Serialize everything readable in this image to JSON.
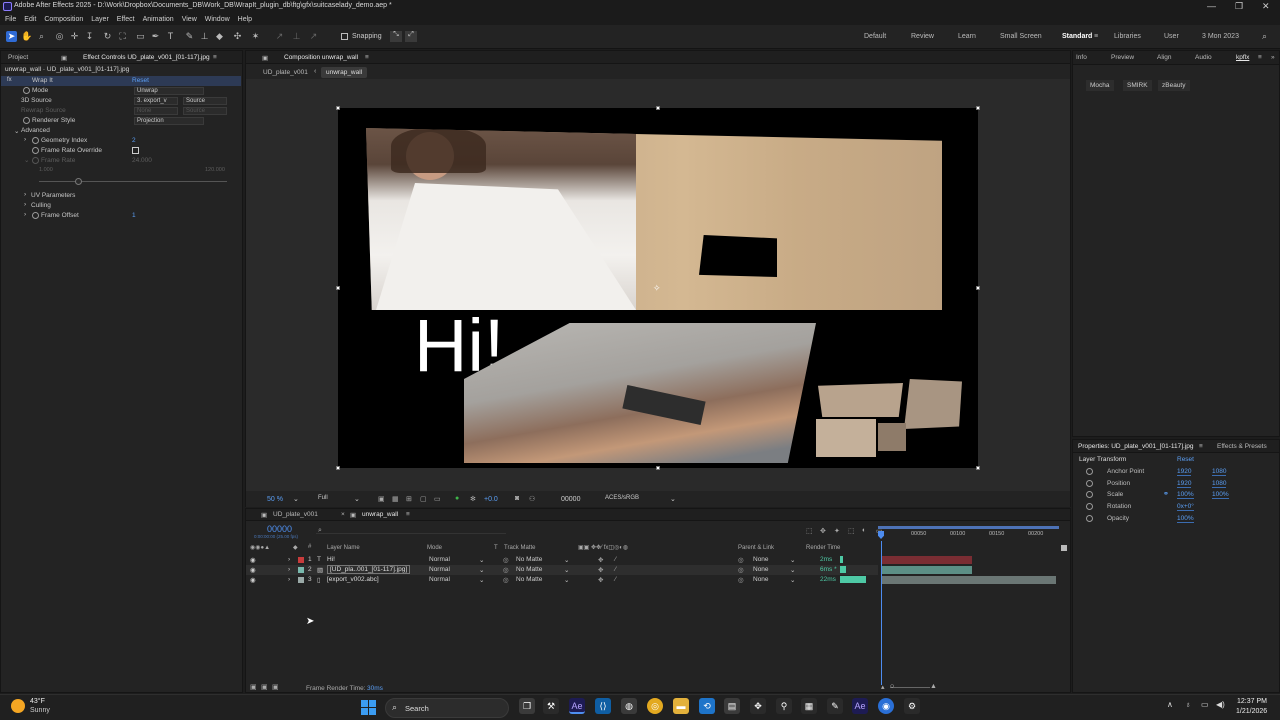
{
  "window": {
    "title": "Adobe After Effects 2025 - D:\\Work\\Dropbox\\Documents_DB\\Work_DB\\WrapIt_plugin_db\\ftg\\gfx\\suitcaselady_demo.aep *",
    "controls": [
      "—",
      "❐",
      "✕"
    ]
  },
  "menu": [
    "File",
    "Edit",
    "Composition",
    "Layer",
    "Effect",
    "Animation",
    "View",
    "Window",
    "Help"
  ],
  "toolbar": {
    "snapping_label": "Snapping",
    "workspaces": [
      "Default",
      "Review",
      "Learn",
      "Small Screen",
      "Standard",
      "Libraries",
      "User",
      "3 Mon 2023"
    ]
  },
  "left_panel": {
    "tabs": [
      "Project",
      "Effect Controls UD_plate_v001_[01-117].jpg"
    ],
    "header": "unwrap_wall · UD_plate_v001_[01-117].jpg",
    "effect_name": "Wrap It",
    "reset": "Reset",
    "mode_label": "Mode",
    "mode_value": "Unwrap",
    "source3d_label": "3D Source",
    "source3d_value": "3. export_v",
    "source3d_value2": "Source",
    "rewrap_label": "Rewrap Source",
    "rewrap_value": "None",
    "rewrap_value2": "Source",
    "renderer_label": "Renderer Style",
    "renderer_value": "Projection",
    "advanced_label": "Advanced",
    "geometry_label": "Geometry Index",
    "geometry_value": "2",
    "framerate_override_label": "Frame Rate Override",
    "framerate_label": "Frame Rate",
    "framerate_value": "24.000",
    "slider_min": "1.000",
    "slider_max": "120.000",
    "uv_label": "UV Parameters",
    "culling_label": "Culling",
    "frame_offset_label": "Frame Offset",
    "frame_offset_value": "1"
  },
  "comp_panel": {
    "tab": "Composition unwrap_wall",
    "breadcrumbs": [
      "UD_plate_v001",
      "unwrap_wall"
    ],
    "overlay_text": "Hi!",
    "zoom": "50 %",
    "resolution": "Full",
    "exposure": "+0.0",
    "timecode": "00000",
    "color_space": "ACES/sRGB"
  },
  "right_panel": {
    "tabs": [
      "Info",
      "Preview",
      "Align",
      "Audio",
      "kpflx"
    ],
    "buttons": [
      "Mocha",
      "SMIRK",
      "zBeauty"
    ]
  },
  "properties": {
    "tab": "Properties: UD_plate_v001_[01-117].jpg",
    "tab2": "Effects & Presets",
    "section": "Layer Transform",
    "reset": "Reset",
    "rows": [
      {
        "label": "Anchor Point",
        "v1": "1920",
        "v2": "1080"
      },
      {
        "label": "Position",
        "v1": "1920",
        "v2": "1080"
      },
      {
        "label": "Scale",
        "v1": "100%",
        "v2": "100%"
      },
      {
        "label": "Rotation",
        "v1": "0x+0°",
        "v2": ""
      },
      {
        "label": "Opacity",
        "v1": "100%",
        "v2": ""
      }
    ]
  },
  "timeline": {
    "tabs": [
      "UD_plate_v001",
      "unwrap_wall"
    ],
    "timecode": "00000",
    "timecode_sub": "0:00:00:00 (25.00 fps)",
    "headers": [
      "Layer Name",
      "Mode",
      "T",
      "Track Matte",
      "Parent & Link",
      "Render Time"
    ],
    "ruler": [
      "00050",
      "00100",
      "00150",
      "00200"
    ],
    "layers": [
      {
        "num": "1",
        "name": "Hi!",
        "mode": "Normal",
        "matte": "No Matte",
        "parent": "None",
        "render": "2ms",
        "color": "#c83c3c"
      },
      {
        "num": "2",
        "name": "[UD_pla..001_[01-117].jpg]",
        "mode": "Normal",
        "matte": "No Matte",
        "parent": "None",
        "render": "6ms *",
        "color": "#79b9ad"
      },
      {
        "num": "3",
        "name": "[export_v002.abc]",
        "mode": "Normal",
        "matte": "No Matte",
        "parent": "None",
        "render": "22ms",
        "color": "#9aa9a7"
      }
    ],
    "frame_render_label": "Frame Render Time:",
    "frame_render_value": "30ms"
  },
  "taskbar": {
    "weather_temp": "43°F",
    "weather_desc": "Sunny",
    "search": "Search",
    "time": "12:37 PM",
    "date": "1/21/2026"
  }
}
